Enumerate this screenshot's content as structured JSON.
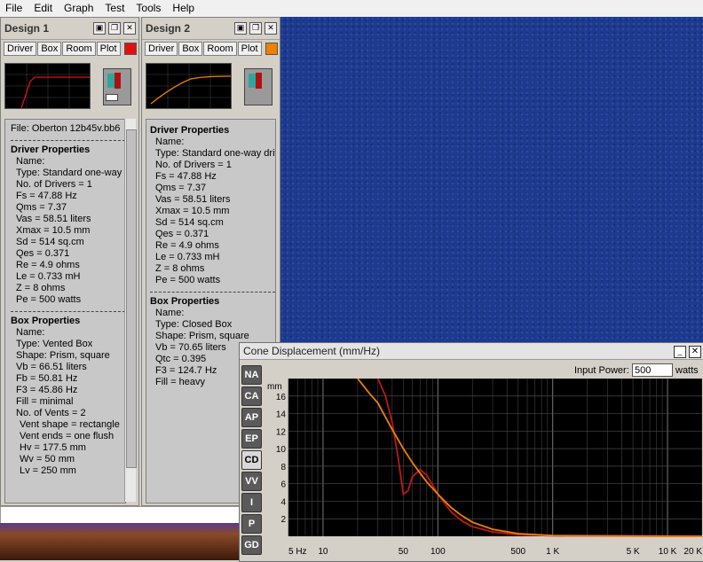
{
  "menu": [
    "File",
    "Edit",
    "Graph",
    "Test",
    "Tools",
    "Help"
  ],
  "design1": {
    "title": "Design 1",
    "tabs": [
      "Driver",
      "Box",
      "Room",
      "Plot"
    ],
    "swatch": "#e01010",
    "file": "File: Oberton 12b45v.bb6",
    "driver_header": "Driver Properties",
    "driver": [
      "Name:",
      "Type: Standard one-way",
      "No. of Drivers = 1",
      "Fs = 47.88 Hz",
      "Qms = 7.37",
      "Vas = 58.51 liters",
      "Xmax = 10.5 mm",
      "Sd = 514 sq.cm",
      "Qes = 0.371",
      "Re = 4.9 ohms",
      "Le = 0.733 mH",
      "Z = 8 ohms",
      "Pe = 500 watts"
    ],
    "box_header": "Box Properties",
    "box": [
      "Name:",
      "Type: Vented Box",
      "Shape: Prism, square",
      "Vb = 66.51 liters",
      "Fb = 50.81 Hz",
      "F3 = 45.86 Hz",
      "Fill = minimal",
      "No. of Vents = 2"
    ],
    "vent": [
      "Vent shape = rectangle",
      "Vent ends = one flush",
      "Hv = 177.5 mm",
      "Wv = 50 mm",
      "Lv = 250 mm"
    ]
  },
  "design2": {
    "title": "Design 2",
    "tabs": [
      "Driver",
      "Box",
      "Room",
      "Plot"
    ],
    "swatch": "#f08000",
    "driver_header": "Driver Properties",
    "driver": [
      "Name:",
      "Type: Standard one-way driv",
      "No. of Drivers = 1",
      "Fs = 47.88 Hz",
      "Qms = 7.37",
      "Vas = 58.51 liters",
      "Xmax = 10.5 mm",
      "Sd = 514 sq.cm",
      "Qes = 0.371",
      "Re = 4.9 ohms",
      "Le = 0.733 mH",
      "Z = 8 ohms",
      "Pe = 500 watts"
    ],
    "box_header": "Box Properties",
    "box": [
      "Name:",
      "Type: Closed Box",
      "Shape: Prism, square",
      "Vb = 70.65 liters",
      "Qtc = 0.395",
      "F3 = 124.7 Hz",
      "Fill = heavy"
    ]
  },
  "cone": {
    "title": "Cone Displacement (mm/Hz)",
    "power_label": "Input Power:",
    "power_value": "500",
    "power_unit": "watts",
    "side_buttons": [
      "NA",
      "CA",
      "AP",
      "EP",
      "CD",
      "VV",
      "I",
      "P",
      "GD"
    ],
    "active_button": "CD",
    "y_unit": "mm",
    "y_ticks": [
      "16",
      "14",
      "12",
      "10",
      "8",
      "6",
      "4",
      "2"
    ],
    "x_ticks": [
      "5 Hz",
      "10",
      "50",
      "100",
      "500",
      "1 K",
      "5 K",
      "10 K",
      "20 K"
    ]
  },
  "chart_data": {
    "type": "line",
    "xlabel": "",
    "ylabel": "mm",
    "xscale": "log",
    "xlim": [
      5,
      20000
    ],
    "ylim": [
      0,
      18
    ],
    "series": [
      {
        "color": "#c01818",
        "x": [
          30,
          35,
          40,
          45,
          50,
          55,
          60,
          70,
          80,
          100,
          130,
          160,
          200,
          300,
          500,
          1000,
          20000
        ],
        "y": [
          18,
          16,
          13,
          9,
          4.8,
          5.2,
          6.8,
          7.6,
          7.0,
          4.8,
          2.8,
          1.8,
          1.1,
          0.5,
          0.18,
          0.05,
          0
        ]
      },
      {
        "color": "#f08000",
        "x": [
          20,
          25,
          30,
          40,
          50,
          60,
          70,
          80,
          100,
          130,
          160,
          200,
          300,
          500,
          1000,
          20000
        ],
        "y": [
          18,
          16.4,
          15.2,
          12.2,
          10,
          8.4,
          7.2,
          6.2,
          4.8,
          3.3,
          2.4,
          1.6,
          0.8,
          0.3,
          0.08,
          0
        ]
      }
    ]
  }
}
